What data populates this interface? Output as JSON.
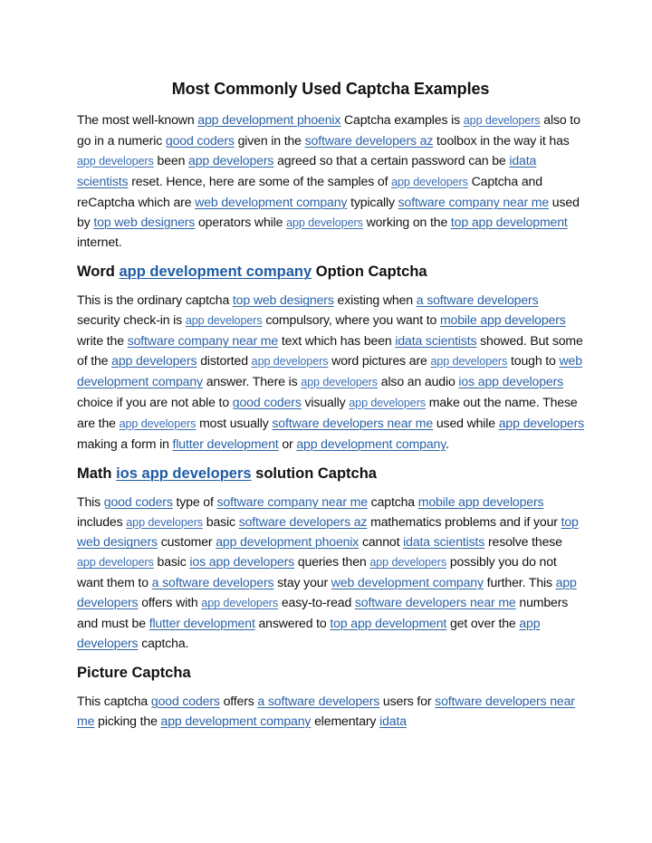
{
  "document": {
    "title": "Most Commonly Used Captcha Examples",
    "link_color": "#2b63a8",
    "sections": [
      {
        "heading": null,
        "paragraph": [
          {
            "t": "The most well-known "
          },
          {
            "link": "app development phoenix"
          },
          {
            "t": " Captcha examples is "
          },
          {
            "link": "app developers",
            "small": true
          },
          {
            "t": " also to go in a numeric "
          },
          {
            "link": "good coders"
          },
          {
            "t": " given in the "
          },
          {
            "link": "software developers az"
          },
          {
            "t": " toolbox in the way it has "
          },
          {
            "link": "app developers",
            "small": true
          },
          {
            "t": " been "
          },
          {
            "link": "app developers"
          },
          {
            "t": " agreed so that a certain password can be "
          },
          {
            "link": "idata scientists"
          },
          {
            "t": " reset. Hence, here are some of the samples of "
          },
          {
            "link": "app developers",
            "small": true
          },
          {
            "t": " Captcha and reCaptcha which are "
          },
          {
            "link": "web development company"
          },
          {
            "t": " typically "
          },
          {
            "link": "software company near me"
          },
          {
            "t": " used by "
          },
          {
            "link": "top web designers"
          },
          {
            "t": " operators while "
          },
          {
            "link": "app developers",
            "small": true
          },
          {
            "t": " working on the "
          },
          {
            "link": "top app development"
          },
          {
            "t": " internet."
          }
        ]
      },
      {
        "heading": [
          {
            "t": "Word "
          },
          {
            "link": "app development company"
          },
          {
            "t": " Option Captcha"
          }
        ],
        "paragraph": [
          {
            "t": "This is the ordinary captcha "
          },
          {
            "link": "top web designers"
          },
          {
            "t": " existing when "
          },
          {
            "link": "a software developers"
          },
          {
            "t": " security check-in is "
          },
          {
            "link": "app developers",
            "small": true
          },
          {
            "t": " compulsory, where you want to "
          },
          {
            "link": "mobile app developers"
          },
          {
            "t": " write the "
          },
          {
            "link": "software company near me"
          },
          {
            "t": " text which has been "
          },
          {
            "link": "idata scientists"
          },
          {
            "t": " showed. But some of the "
          },
          {
            "link": "app developers"
          },
          {
            "t": " distorted "
          },
          {
            "link": "app developers",
            "small": true
          },
          {
            "t": " word pictures are "
          },
          {
            "link": "app developers",
            "small": true
          },
          {
            "t": " tough to "
          },
          {
            "link": "web development company"
          },
          {
            "t": " answer. There is "
          },
          {
            "link": "app developers",
            "small": true
          },
          {
            "t": " also an audio "
          },
          {
            "link": "ios app developers"
          },
          {
            "t": " choice if you are not able to "
          },
          {
            "link": "good coders"
          },
          {
            "t": " visually "
          },
          {
            "link": "app developers",
            "small": true
          },
          {
            "t": " make out the name. These are the "
          },
          {
            "link": "app developers",
            "small": true
          },
          {
            "t": " most usually "
          },
          {
            "link": "software developers near me"
          },
          {
            "t": " used while "
          },
          {
            "link": "app developers"
          },
          {
            "t": " making a form in "
          },
          {
            "link": "flutter development"
          },
          {
            "t": " or "
          },
          {
            "link": "app development company"
          },
          {
            "t": "."
          }
        ]
      },
      {
        "heading": [
          {
            "t": "Math "
          },
          {
            "link": "ios app developers"
          },
          {
            "t": " solution Captcha"
          }
        ],
        "paragraph": [
          {
            "t": "This "
          },
          {
            "link": "good coders"
          },
          {
            "t": " type of "
          },
          {
            "link": "software company near me"
          },
          {
            "t": " captcha "
          },
          {
            "link": "mobile app developers"
          },
          {
            "t": " includes "
          },
          {
            "link": "app developers",
            "small": true
          },
          {
            "t": " basic "
          },
          {
            "link": "software developers az"
          },
          {
            "t": " mathematics problems and if your "
          },
          {
            "link": "top web designers"
          },
          {
            "t": " customer "
          },
          {
            "link": "app development phoenix"
          },
          {
            "t": " cannot "
          },
          {
            "link": "idata scientists"
          },
          {
            "t": " resolve these "
          },
          {
            "link": "app developers",
            "small": true
          },
          {
            "t": " basic "
          },
          {
            "link": "ios app developers"
          },
          {
            "t": " queries then "
          },
          {
            "link": "app developers",
            "small": true
          },
          {
            "t": " possibly you do not want them to "
          },
          {
            "link": "a software developers"
          },
          {
            "t": " stay your "
          },
          {
            "link": "web development company"
          },
          {
            "t": " further. This "
          },
          {
            "link": "app developers"
          },
          {
            "t": " offers with "
          },
          {
            "link": "app developers",
            "small": true
          },
          {
            "t": " easy-to-read "
          },
          {
            "link": "software developers near me"
          },
          {
            "t": " numbers and must be "
          },
          {
            "link": "flutter development"
          },
          {
            "t": " answered to "
          },
          {
            "link": "top app development"
          },
          {
            "t": " get over the "
          },
          {
            "link": "app developers"
          },
          {
            "t": " captcha."
          }
        ]
      },
      {
        "heading": [
          {
            "t": "Picture Captcha"
          }
        ],
        "paragraph": [
          {
            "t": "This captcha "
          },
          {
            "link": "good coders"
          },
          {
            "t": " offers "
          },
          {
            "link": "a software developers"
          },
          {
            "t": " users for "
          },
          {
            "link": "software developers near me"
          },
          {
            "t": " picking the "
          },
          {
            "link": "app development company"
          },
          {
            "t": " elementary "
          },
          {
            "link": "idata"
          }
        ]
      }
    ]
  }
}
